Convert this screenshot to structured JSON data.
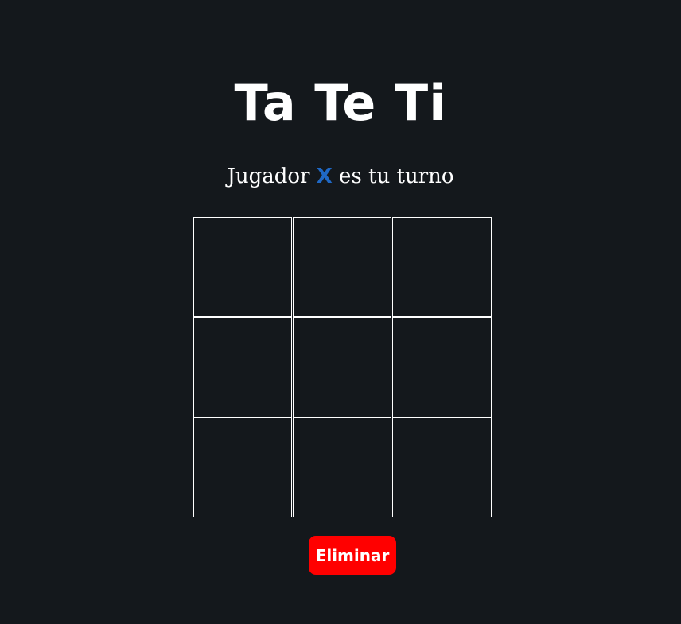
{
  "header": {
    "title": "Ta Te Ti"
  },
  "status": {
    "prefix": "Jugador ",
    "player": "X",
    "suffix": " es tu turno",
    "player_color": "#1f68c5"
  },
  "board": {
    "cells": [
      "",
      "",
      "",
      "",
      "",
      "",
      "",
      "",
      ""
    ]
  },
  "controls": {
    "reset_label": "Eliminar",
    "reset_color": "#ff0000"
  },
  "theme": {
    "background": "#14181c",
    "text": "#ffffff",
    "grid_line": "#ffffff"
  }
}
